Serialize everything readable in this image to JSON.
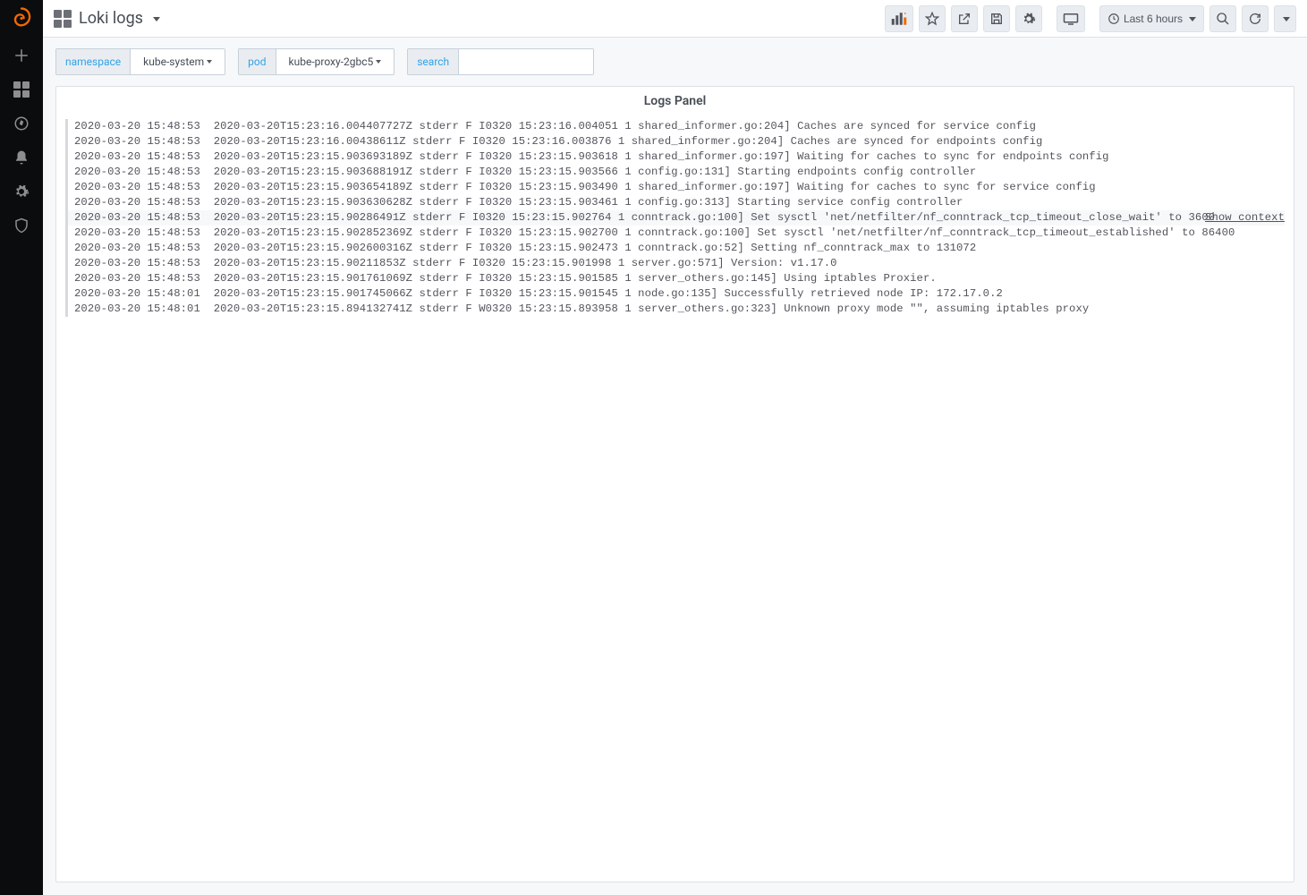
{
  "header": {
    "title": "Loki logs",
    "time_label": "Last 6 hours"
  },
  "variables": {
    "namespace_label": "namespace",
    "namespace_value": "kube-system",
    "pod_label": "pod",
    "pod_value": "kube-proxy-2gbc5",
    "search_label": "search",
    "search_value": ""
  },
  "panel": {
    "title": "Logs Panel",
    "show_context_label": "Show context"
  },
  "logs": [
    {
      "ts": "2020-03-20 15:48:53",
      "msg": "2020-03-20T15:23:16.004407727Z stderr F I0320 15:23:16.004051 1 shared_informer.go:204] Caches are synced for service config"
    },
    {
      "ts": "2020-03-20 15:48:53",
      "msg": "2020-03-20T15:23:16.00438611Z stderr F I0320 15:23:16.003876 1 shared_informer.go:204] Caches are synced for endpoints config"
    },
    {
      "ts": "2020-03-20 15:48:53",
      "msg": "2020-03-20T15:23:15.903693189Z stderr F I0320 15:23:15.903618 1 shared_informer.go:197] Waiting for caches to sync for endpoints config"
    },
    {
      "ts": "2020-03-20 15:48:53",
      "msg": "2020-03-20T15:23:15.903688191Z stderr F I0320 15:23:15.903566 1 config.go:131] Starting endpoints config controller"
    },
    {
      "ts": "2020-03-20 15:48:53",
      "msg": "2020-03-20T15:23:15.903654189Z stderr F I0320 15:23:15.903490 1 shared_informer.go:197] Waiting for caches to sync for service config"
    },
    {
      "ts": "2020-03-20 15:48:53",
      "msg": "2020-03-20T15:23:15.903630628Z stderr F I0320 15:23:15.903461 1 config.go:313] Starting service config controller"
    },
    {
      "ts": "2020-03-20 15:48:53",
      "msg": "2020-03-20T15:23:15.90286491Z stderr F I0320 15:23:15.902764 1 conntrack.go:100] Set sysctl 'net/netfilter/nf_conntrack_tcp_timeout_close_wait' to 3600",
      "context": true
    },
    {
      "ts": "2020-03-20 15:48:53",
      "msg": "2020-03-20T15:23:15.902852369Z stderr F I0320 15:23:15.902700 1 conntrack.go:100] Set sysctl 'net/netfilter/nf_conntrack_tcp_timeout_established' to 86400"
    },
    {
      "ts": "2020-03-20 15:48:53",
      "msg": "2020-03-20T15:23:15.902600316Z stderr F I0320 15:23:15.902473 1 conntrack.go:52] Setting nf_conntrack_max to 131072"
    },
    {
      "ts": "2020-03-20 15:48:53",
      "msg": "2020-03-20T15:23:15.90211853Z stderr F I0320 15:23:15.901998 1 server.go:571] Version: v1.17.0"
    },
    {
      "ts": "2020-03-20 15:48:53",
      "msg": "2020-03-20T15:23:15.901761069Z stderr F I0320 15:23:15.901585 1 server_others.go:145] Using iptables Proxier."
    },
    {
      "ts": "2020-03-20 15:48:01",
      "msg": "2020-03-20T15:23:15.901745066Z stderr F I0320 15:23:15.901545 1 node.go:135] Successfully retrieved node IP: 172.17.0.2"
    },
    {
      "ts": "2020-03-20 15:48:01",
      "msg": "2020-03-20T15:23:15.894132741Z stderr F W0320 15:23:15.893958 1 server_others.go:323] Unknown proxy mode \"\", assuming iptables proxy"
    }
  ]
}
